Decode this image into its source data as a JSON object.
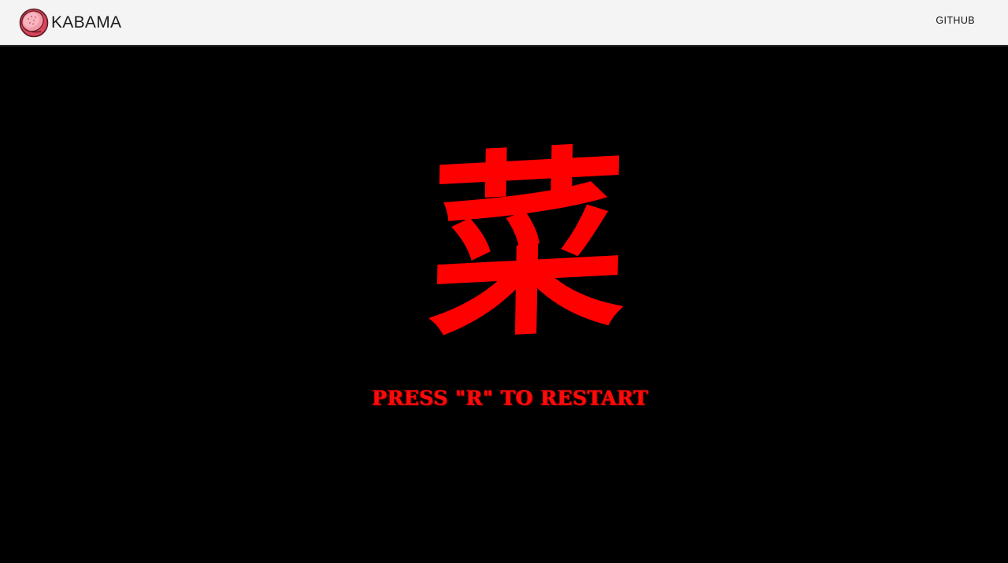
{
  "navbar": {
    "brand_name": "KABAMA",
    "logo_icon": "macaron-icon",
    "github_label": "GITHUB",
    "background_color": "#f4f4f4"
  },
  "game": {
    "kanji": "菜",
    "restart_prompt": "PRESS \"R\" TO RESTART",
    "background_color": "#000000",
    "accent_color": "#ff0000"
  }
}
